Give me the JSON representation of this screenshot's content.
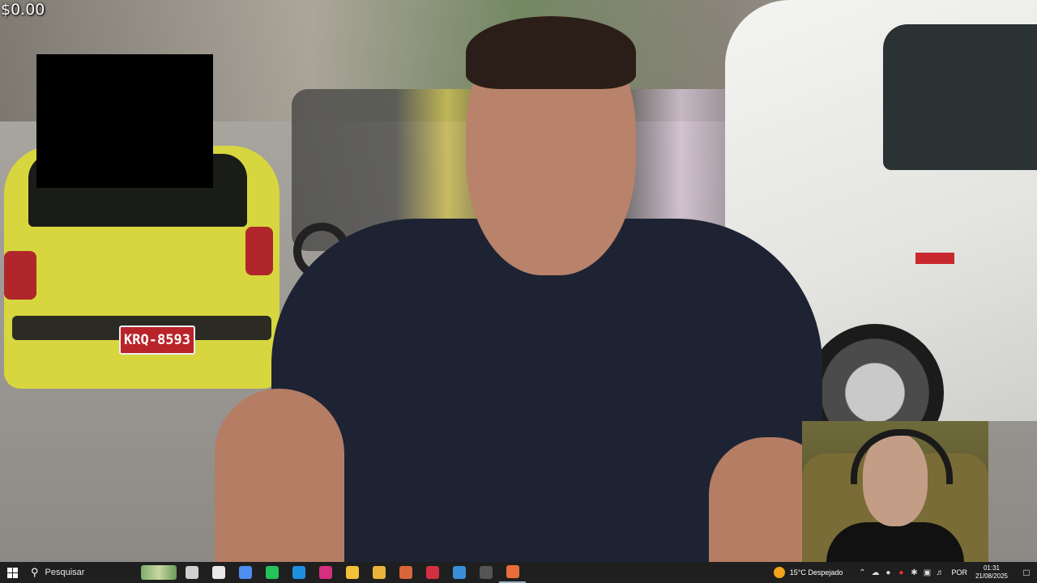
{
  "overlay": {
    "balance": "$0.00"
  },
  "video": {
    "taxi_plate": "KRQ-8593"
  },
  "taskbar": {
    "search_placeholder": "Pesquisar",
    "weather": "15°C  Despejado",
    "language": "POR",
    "time": "01:31",
    "date": "21/08/2025",
    "icons": [
      {
        "name": "task-view-icon",
        "color": "#d0d0d0"
      },
      {
        "name": "widget-icon",
        "color": "#e8e8e8"
      },
      {
        "name": "copilot-icon",
        "color": "#4d8ef0"
      },
      {
        "name": "whatsapp-icon",
        "color": "#25c15a"
      },
      {
        "name": "edge-icon",
        "color": "#1f8fe0"
      },
      {
        "name": "instagram-icon",
        "color": "#d4307d"
      },
      {
        "name": "file-explorer-icon",
        "color": "#f2c13a"
      },
      {
        "name": "chrome-icon",
        "color": "#e9b43a"
      },
      {
        "name": "app-icon",
        "color": "#d9653a"
      },
      {
        "name": "app-red-icon",
        "color": "#d23040"
      },
      {
        "name": "app-blue-icon",
        "color": "#3a8ed8"
      },
      {
        "name": "obs-icon",
        "color": "#555555"
      },
      {
        "name": "chrome-active-icon",
        "color": "#e96d3a"
      }
    ]
  }
}
